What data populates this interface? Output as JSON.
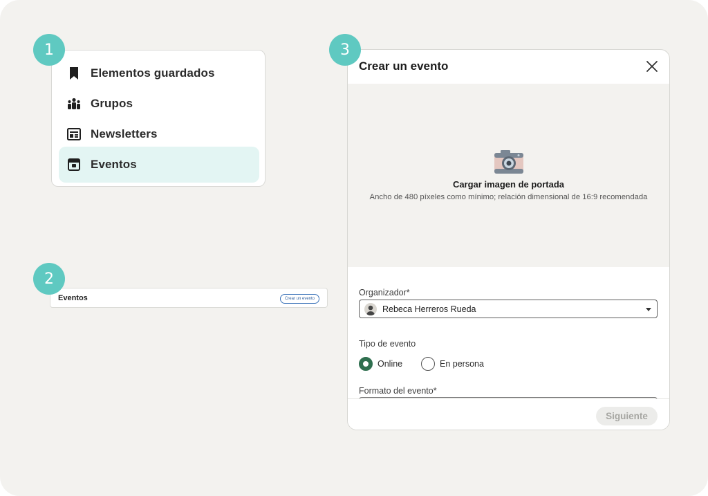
{
  "steps": [
    "1",
    "2",
    "3"
  ],
  "menu": {
    "items": [
      {
        "label": "Elementos guardados",
        "icon": "bookmark-icon"
      },
      {
        "label": "Grupos",
        "icon": "groups-icon"
      },
      {
        "label": "Newsletters",
        "icon": "newsletter-icon"
      },
      {
        "label": "Eventos",
        "icon": "calendar-icon",
        "active": true
      }
    ]
  },
  "events_bar": {
    "title": "Eventos",
    "button": "Crear un evento"
  },
  "modal": {
    "title": "Crear un evento",
    "close_icon": "close-icon",
    "cover": {
      "icon": "camera-icon",
      "title": "Cargar imagen de portada",
      "subtitle": "Ancho de 480 píxeles como mínimo; relación dimensional de 16:9 recomendada"
    },
    "organizer": {
      "label": "Organizador*",
      "value": "Rebeca Herreros Rueda"
    },
    "event_type": {
      "label": "Tipo de evento",
      "options": [
        "Online",
        "En persona"
      ],
      "selected": "Online"
    },
    "format": {
      "label": "Formato del evento*"
    },
    "next_button": "Siguiente"
  },
  "colors": {
    "background": "#f3f2ef",
    "step_badge": "#5fc9c1",
    "active_item": "#e3f5f3",
    "radio_selected": "#2f6f4f"
  }
}
